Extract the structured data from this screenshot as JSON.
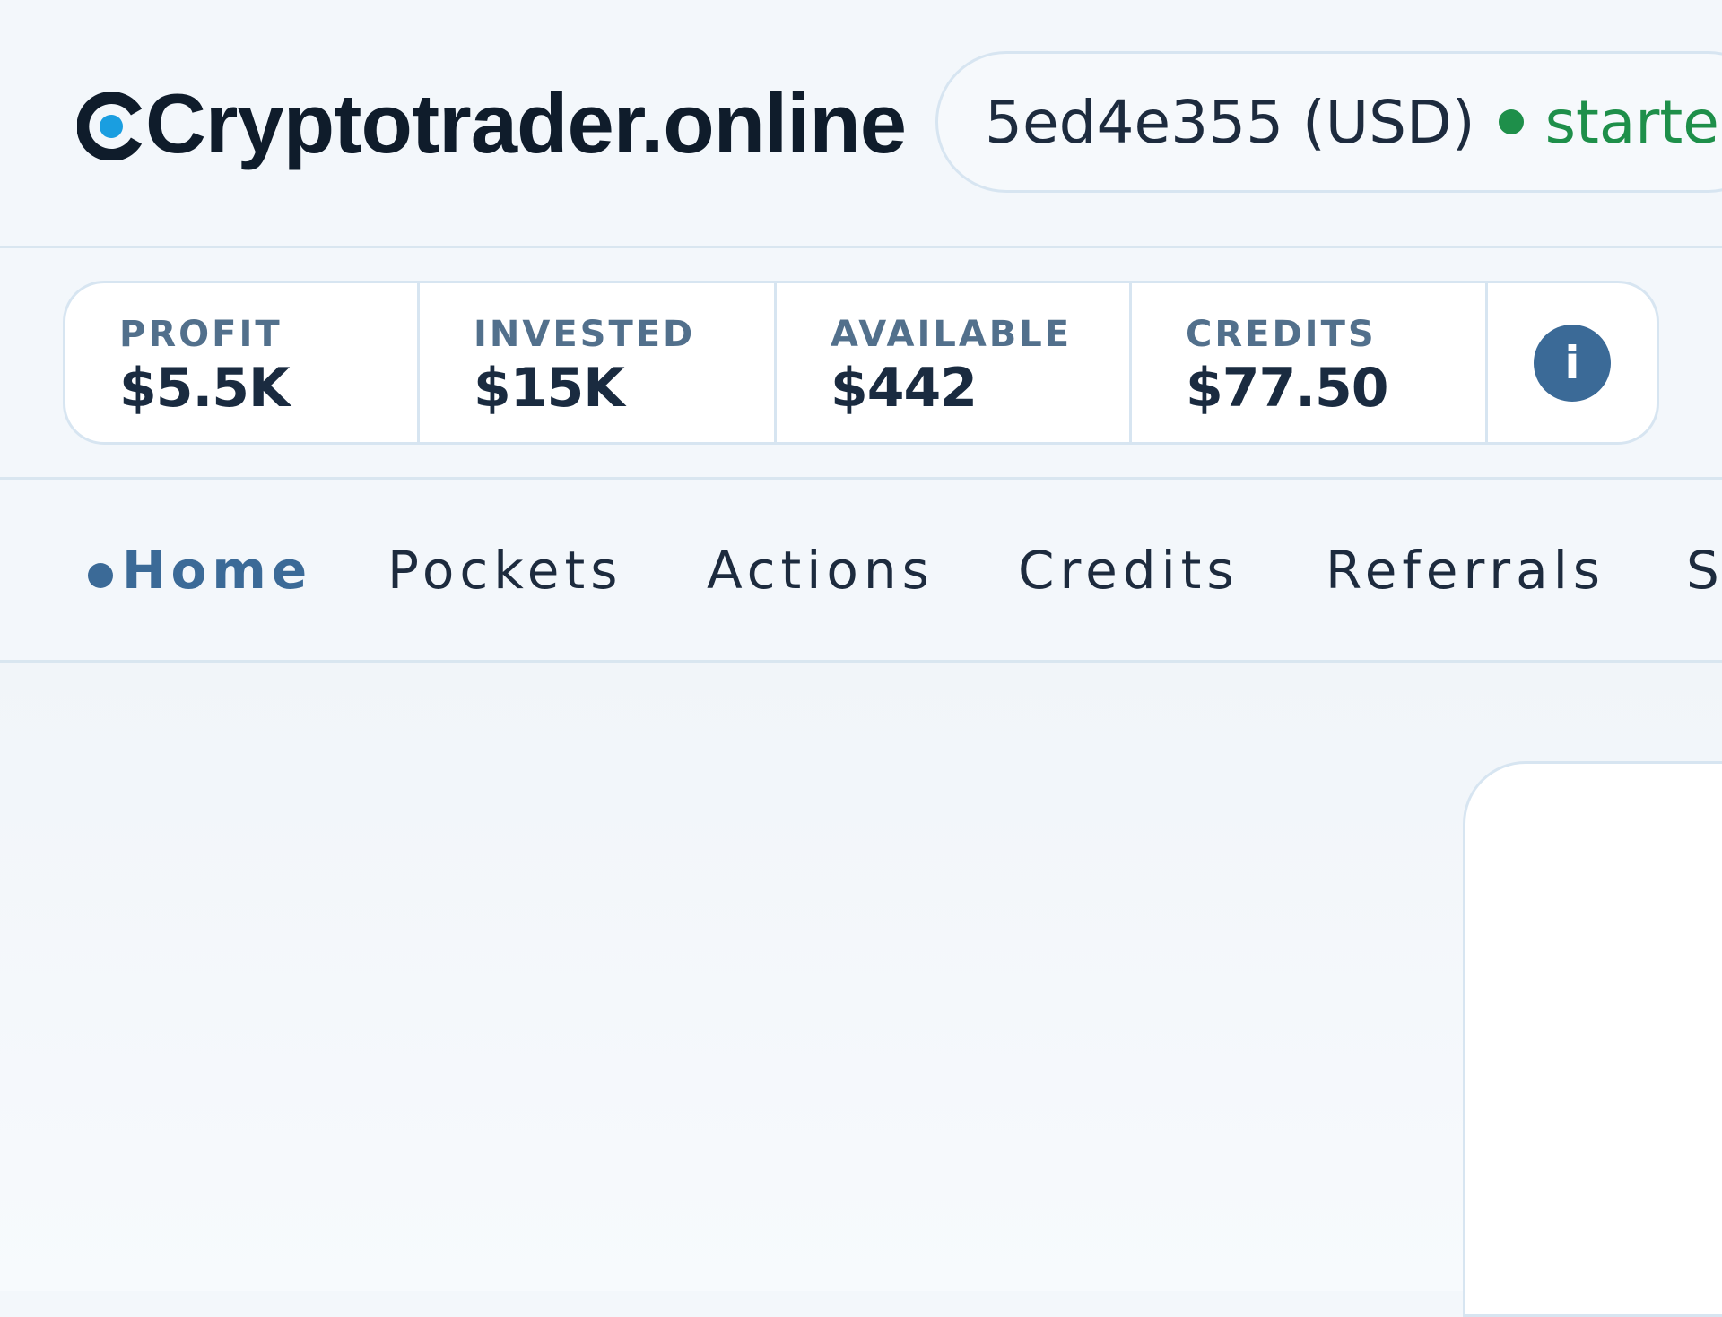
{
  "app": {
    "logo_text": "Cryptotrader.online"
  },
  "session": {
    "id": "5ed4e355 (USD)",
    "status": "started",
    "status_color": "#1e8f4a"
  },
  "stats": [
    {
      "label": "PROFIT",
      "value": "$5.5K"
    },
    {
      "label": "INVESTED",
      "value": "$15K"
    },
    {
      "label": "AVAILABLE",
      "value": "$442"
    },
    {
      "label": "CREDITS",
      "value": "$77.50"
    }
  ],
  "info": {
    "glyph": "i"
  },
  "nav": {
    "items": [
      {
        "label": "Home",
        "active": true
      },
      {
        "label": "Pockets"
      },
      {
        "label": "Actions"
      },
      {
        "label": "Credits"
      },
      {
        "label": "Referrals"
      },
      {
        "label": "S"
      }
    ]
  },
  "colors": {
    "accent": "#3b6a97",
    "logo_dot": "#1a9ee0",
    "background": "#f3f7fb",
    "border": "#d7e5f1"
  }
}
